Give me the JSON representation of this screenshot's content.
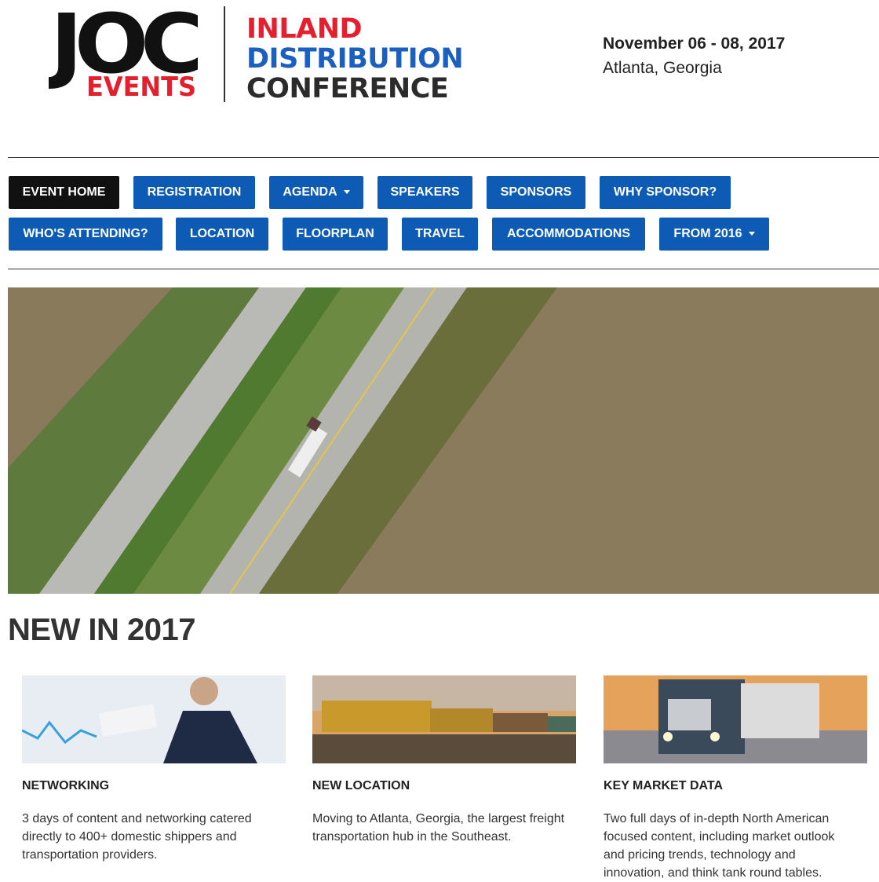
{
  "logo": {
    "joc": "JOC",
    "events": "EVENTS",
    "line1": "INLAND",
    "line2": "DISTRIBUTION",
    "line3": "CONFERENCE"
  },
  "event": {
    "date": "November 06 - 08, 2017",
    "place": "Atlanta, Georgia"
  },
  "nav": {
    "row1": [
      {
        "label": "EVENT HOME",
        "active": true
      },
      {
        "label": "REGISTRATION"
      },
      {
        "label": "AGENDA",
        "dropdown": true
      },
      {
        "label": "SPEAKERS"
      },
      {
        "label": "SPONSORS"
      },
      {
        "label": "WHY SPONSOR?"
      }
    ],
    "row2": [
      {
        "label": "WHO'S ATTENDING?"
      },
      {
        "label": "LOCATION"
      },
      {
        "label": "FLOORPLAN"
      },
      {
        "label": "TRAVEL"
      },
      {
        "label": "ACCOMMODATIONS"
      },
      {
        "label": "FROM 2016",
        "dropdown": true
      }
    ]
  },
  "section": {
    "title": "NEW IN 2017"
  },
  "cards": [
    {
      "title": "NETWORKING",
      "text": "3 days of content and networking catered directly to 400+ domestic shippers and transportation providers."
    },
    {
      "title": "NEW LOCATION",
      "text": "Moving to Atlanta, Georgia, the largest freight transportation hub in the Southeast."
    },
    {
      "title": "KEY MARKET DATA",
      "text": "Two full days of in-depth North American focused content, including market outlook and pricing trends, technology and innovation, and think tank round tables."
    }
  ],
  "colors": {
    "brand_blue": "#0d5bb4",
    "brand_red": "#e4202f",
    "active_nav": "#111111"
  }
}
